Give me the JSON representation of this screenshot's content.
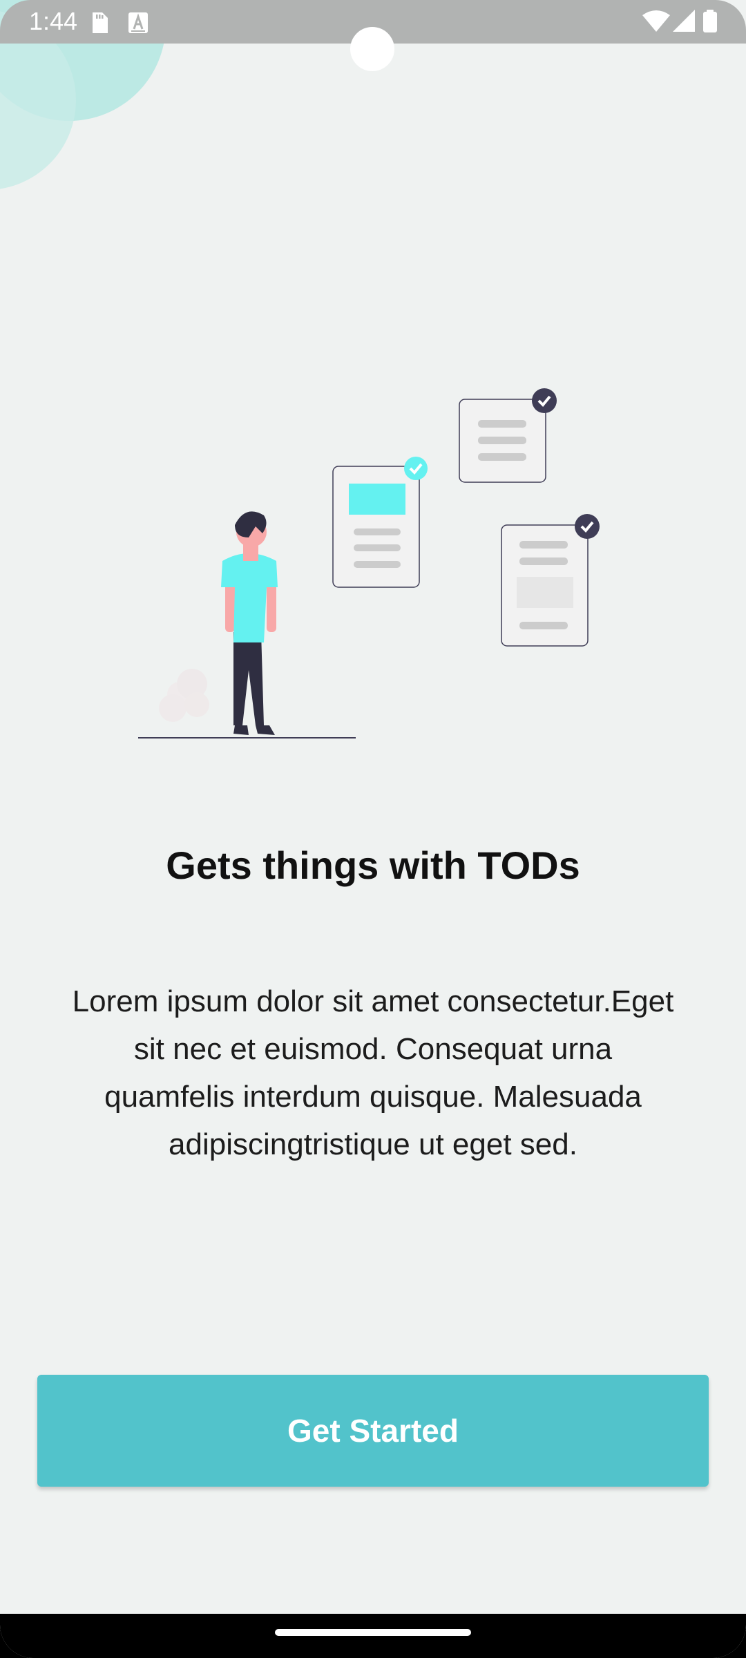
{
  "status_bar": {
    "time": "1:44",
    "left_icons": [
      "sd-card-icon",
      "keyboard-a-icon"
    ],
    "right_icons": [
      "wifi-icon",
      "cell-signal-icon",
      "battery-icon"
    ]
  },
  "onboarding": {
    "title": "Gets things with TODs",
    "description": "Lorem ipsum dolor sit amet consectetur.Eget sit nec et euismod. Consequat urna quamfelis interdum quisque. Malesuada adipiscingtristique ut eget sed.",
    "cta_label": "Get Started"
  },
  "colors": {
    "accent": "#52c3cb",
    "highlight": "#64f1f0",
    "dark": "#2f2e41",
    "background": "#eff2f1",
    "status_bar": "#b1b3b2"
  }
}
